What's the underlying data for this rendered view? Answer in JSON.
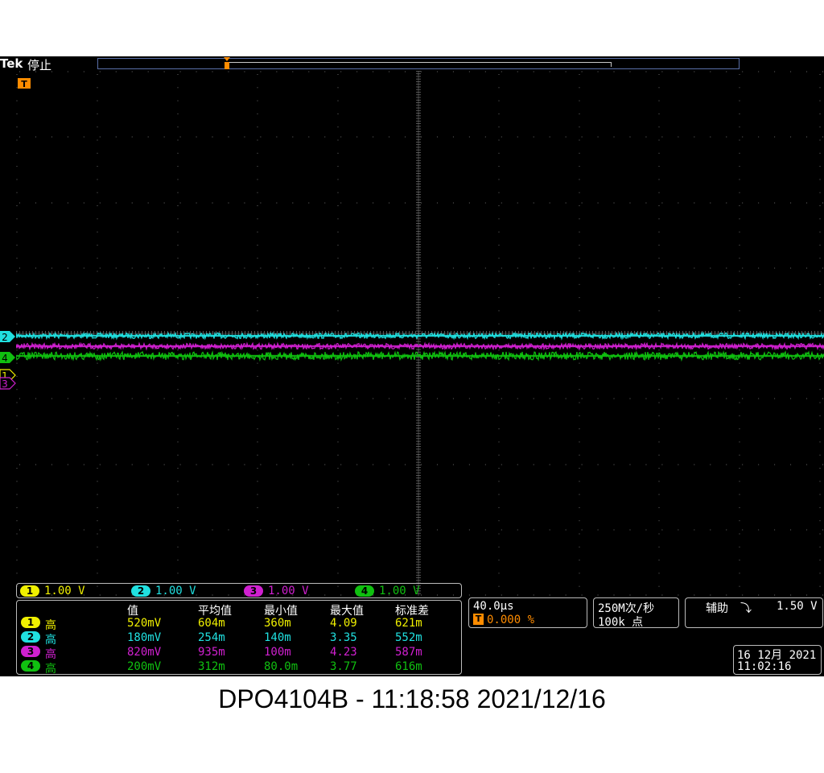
{
  "header": {
    "brand": "Tek",
    "state": "停止"
  },
  "trigger_marker": "T",
  "colors": {
    "ch1": "#f0f000",
    "ch2": "#20e0e0",
    "ch3": "#d020d0",
    "ch4": "#10c010",
    "trigger": "#ff8c00",
    "grid": "#6a6a6a"
  },
  "channel_markers": [
    "2",
    "4",
    "1",
    "3"
  ],
  "channels": [
    {
      "num": "1",
      "scale": "1.00 V"
    },
    {
      "num": "2",
      "scale": "1.00 V"
    },
    {
      "num": "3",
      "scale": "1.00 V"
    },
    {
      "num": "4",
      "scale": "1.00 V"
    }
  ],
  "measurements": {
    "headers": [
      "值",
      "平均值",
      "最小值",
      "最大值",
      "标准差"
    ],
    "rows": [
      {
        "ch": "1",
        "type": "高",
        "value": "520mV",
        "mean": "604m",
        "min": "360m",
        "max": "4.09",
        "std": "621m"
      },
      {
        "ch": "2",
        "type": "高",
        "value": "180mV",
        "mean": "254m",
        "min": "140m",
        "max": "3.35",
        "std": "552m"
      },
      {
        "ch": "3",
        "type": "高",
        "value": "820mV",
        "mean": "935m",
        "min": "100m",
        "max": "4.23",
        "std": "587m"
      },
      {
        "ch": "4",
        "type": "高",
        "value": "200mV",
        "mean": "312m",
        "min": "80.0m",
        "max": "3.77",
        "std": "616m"
      }
    ]
  },
  "horizontal": {
    "scale": "40.0µs",
    "trigger_pos": "0.000 %"
  },
  "acquisition": {
    "rate": "250M次/秒",
    "points": "100k 点"
  },
  "trigger": {
    "source": "辅助",
    "slope_icon": "falling-edge-icon",
    "slope_glyph": "⤵",
    "level": "1.50 V"
  },
  "datetime": {
    "date": "16 12月 2021",
    "time": "11:02:16"
  },
  "caption": "DPO4104B - 11:18:58   2021/12/16"
}
